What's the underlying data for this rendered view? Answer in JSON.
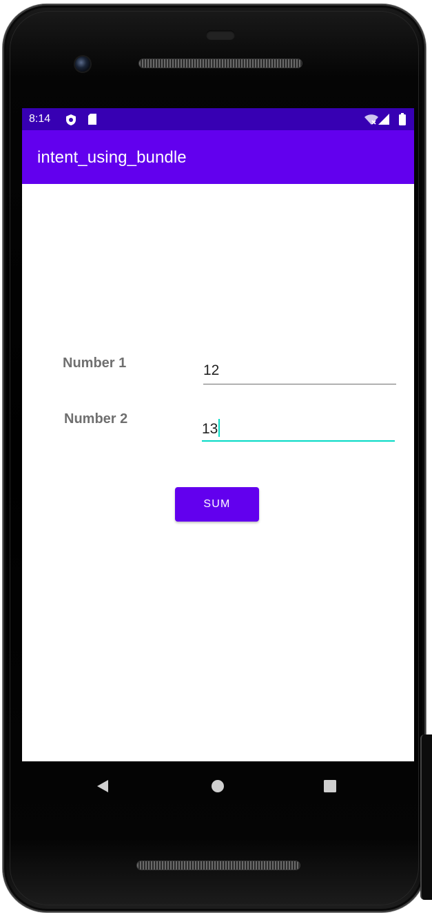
{
  "status_bar": {
    "time": "8:14",
    "icons": [
      "shield-icon",
      "sdcard-icon",
      "wifi-icon",
      "signal-icon",
      "battery-icon"
    ],
    "background_color": "#3700b3"
  },
  "app_bar": {
    "title": "intent_using_bundle",
    "background_color": "#6200ee"
  },
  "form": {
    "number1": {
      "label": "Number 1",
      "value": "12"
    },
    "number2": {
      "label": "Number 2",
      "value": "13",
      "focused": true
    }
  },
  "sum_button": {
    "label": "SUM",
    "color": "#6200ee"
  },
  "nav_bar": {
    "icons": [
      "back-icon",
      "home-icon",
      "recents-icon"
    ]
  },
  "colors": {
    "accent": "#03dac5",
    "label_text": "#6f6f6f"
  }
}
